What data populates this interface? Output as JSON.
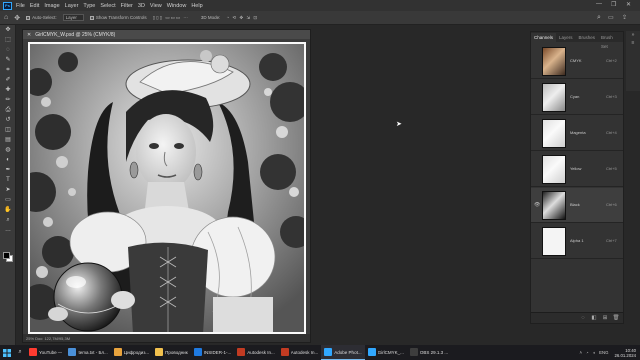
{
  "menubar": {
    "items": [
      "File",
      "Edit",
      "Image",
      "Layer",
      "Type",
      "Select",
      "Filter",
      "3D",
      "View",
      "Window",
      "Help"
    ],
    "window_controls": [
      "—",
      "❐",
      "✕"
    ]
  },
  "options_bar": {
    "auto_select_label": "Auto-Select:",
    "auto_select_value": "Layer",
    "transform_label": "Show Transform Controls",
    "mode_label": "3D Mode:"
  },
  "toolbar": {
    "tools": [
      "move-tool",
      "marquee-tool",
      "lasso-tool",
      "quick-select-tool",
      "crop-tool",
      "eyedropper-tool",
      "healing-tool",
      "brush-tool",
      "stamp-tool",
      "history-brush-tool",
      "eraser-tool",
      "gradient-tool",
      "blur-tool",
      "dodge-tool",
      "pen-tool",
      "type-tool",
      "path-select-tool",
      "shape-tool",
      "hand-tool",
      "zoom-tool",
      "more-tools"
    ],
    "glyphs": [
      "✥",
      "⬚",
      "◌",
      "✎",
      "⌗",
      "✐",
      "✚",
      "✏",
      "⎙",
      "↺",
      "◫",
      "▤",
      "◍",
      "◐",
      "✒",
      "T",
      "➤",
      "▭",
      "✋",
      "⌕",
      "…"
    ],
    "foreground_color": "#000000",
    "background_color": "#ffffff"
  },
  "document": {
    "tab_title": "GirlCMYK_W.psd @ 25% (CMYK/8)",
    "status_text": "25%    Doc: 122,7M/95,3M"
  },
  "channels_panel": {
    "tabs": [
      "Channels",
      "Layers",
      "Brushes",
      "Brush Set"
    ],
    "active_tab": "Channels",
    "channels": [
      {
        "name": "CMYK",
        "shortcut": "Ctrl+2",
        "visible": false,
        "selected": false,
        "thumb": "color"
      },
      {
        "name": "Cyan",
        "shortcut": "Ctrl+3",
        "visible": false,
        "selected": false,
        "thumb": "gray"
      },
      {
        "name": "Magenta",
        "shortcut": "Ctrl+4",
        "visible": false,
        "selected": false,
        "thumb": "light"
      },
      {
        "name": "Yellow",
        "shortcut": "Ctrl+5",
        "visible": false,
        "selected": false,
        "thumb": "light"
      },
      {
        "name": "Black",
        "shortcut": "Ctrl+6",
        "visible": true,
        "selected": true,
        "thumb": "dark"
      },
      {
        "name": "Alpha 1",
        "shortcut": "Ctrl+7",
        "visible": false,
        "selected": false,
        "thumb": "white"
      }
    ],
    "footer_icons": [
      "dotted-circle-icon",
      "mask-icon",
      "new-channel-icon",
      "trash-icon"
    ],
    "footer_glyphs": [
      "◌",
      "◧",
      "⊞",
      "🗑"
    ]
  },
  "taskbar": {
    "items": [
      {
        "label": "YouTube —",
        "color": "#ff3b30",
        "active": false
      },
      {
        "label": "tema.txt - Бл...",
        "color": "#4a90d9",
        "active": false
      },
      {
        "label": "Цифродиз...",
        "color": "#e8a33d",
        "active": false
      },
      {
        "label": "Проводник",
        "color": "#f2c14e",
        "active": false
      },
      {
        "label": "INSIDER-1-...",
        "color": "#1f7ae0",
        "active": false
      },
      {
        "label": "Autodesk In...",
        "color": "#c23b22",
        "active": false
      },
      {
        "label": "Autodesk In...",
        "color": "#c23b22",
        "active": false
      },
      {
        "label": "Adobe Phot...",
        "color": "#31a8ff",
        "active": true
      },
      {
        "label": "GirlCMYK_...",
        "color": "#31a8ff",
        "active": false
      },
      {
        "label": "OBS 29.1.3 ...",
        "color": "#3d3d3d",
        "active": false
      }
    ],
    "tray_lang": "ENG",
    "time": "10:40",
    "date": "26.01.2024"
  }
}
